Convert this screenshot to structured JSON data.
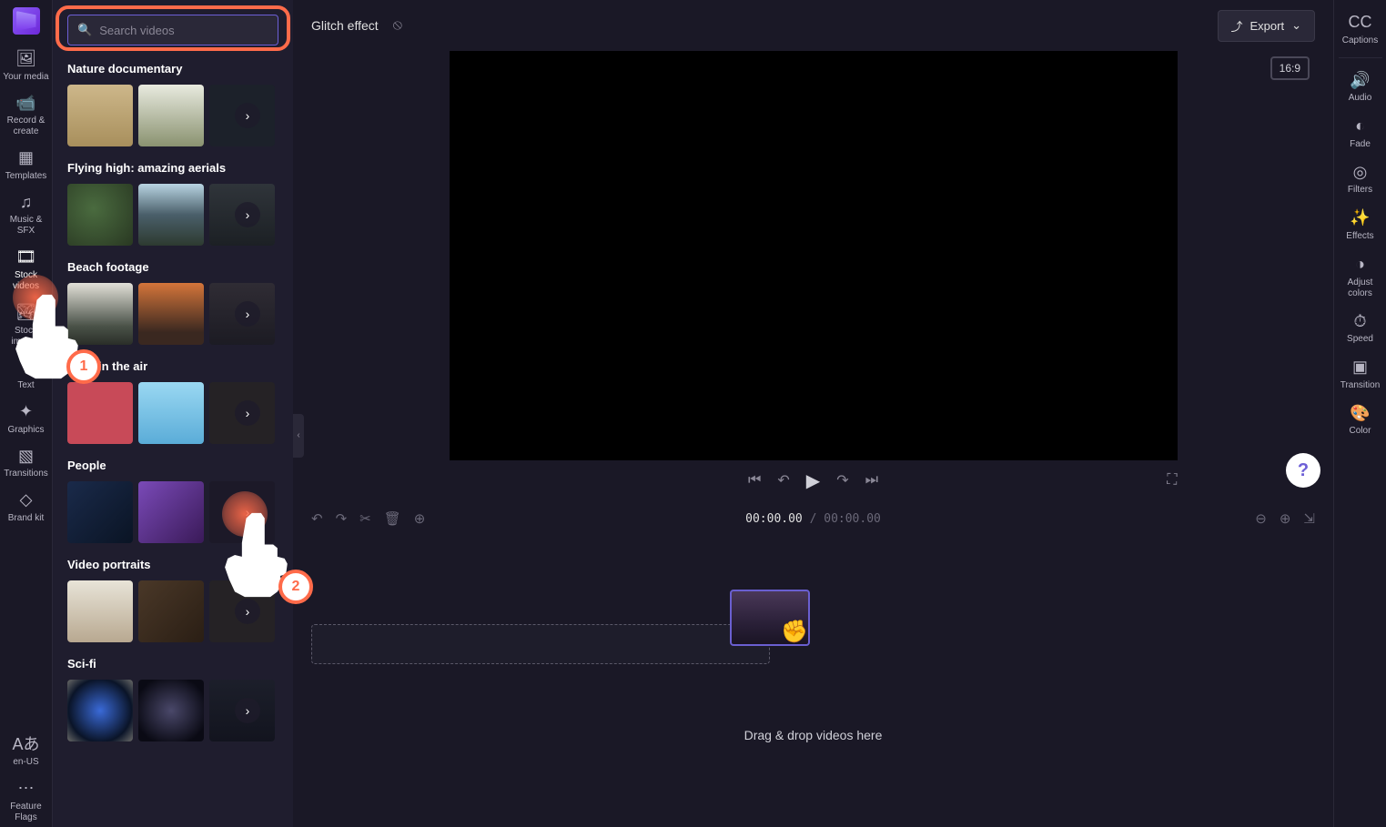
{
  "header": {
    "project_title": "Glitch effect",
    "export_label": "Export",
    "aspect_ratio": "16:9"
  },
  "search": {
    "placeholder": "Search videos",
    "value": ""
  },
  "left_rail": [
    {
      "label": "Your media",
      "icon": "🖼"
    },
    {
      "label": "Record & create",
      "icon": "📹"
    },
    {
      "label": "Templates",
      "icon": "▦"
    },
    {
      "label": "Music & SFX",
      "icon": "♫"
    },
    {
      "label": "Stock videos",
      "icon": "🎞"
    },
    {
      "label": "Stock images",
      "icon": "🏞"
    },
    {
      "label": "Text",
      "icon": "T"
    },
    {
      "label": "Graphics",
      "icon": "✦"
    },
    {
      "label": "Transitions",
      "icon": "▧"
    },
    {
      "label": "Brand kit",
      "icon": "◇"
    }
  ],
  "left_rail_bottom": [
    {
      "label": "en-US",
      "icon": "Aあ"
    },
    {
      "label": "Feature Flags",
      "icon": "⋯"
    }
  ],
  "right_rail": [
    {
      "label": "Captions",
      "icon": "CC"
    },
    {
      "label": "Audio",
      "icon": "🔊"
    },
    {
      "label": "Fade",
      "icon": "◐"
    },
    {
      "label": "Filters",
      "icon": "◎"
    },
    {
      "label": "Effects",
      "icon": "✨"
    },
    {
      "label": "Adjust colors",
      "icon": "◑"
    },
    {
      "label": "Speed",
      "icon": "⏱"
    },
    {
      "label": "Transition",
      "icon": "▣"
    },
    {
      "label": "Color",
      "icon": "🎨"
    }
  ],
  "categories": [
    {
      "title": "Nature documentary"
    },
    {
      "title": "Flying high: amazing aerials"
    },
    {
      "title": "Beach footage"
    },
    {
      "title": "Love in the air"
    },
    {
      "title": "People"
    },
    {
      "title": "Video portraits"
    },
    {
      "title": "Sci-fi"
    }
  ],
  "timeline": {
    "current": "00:00.00",
    "total": "00:00.00",
    "drop_hint": "Drag & drop videos here"
  },
  "tutorial": {
    "step1": "1",
    "step2": "2"
  }
}
